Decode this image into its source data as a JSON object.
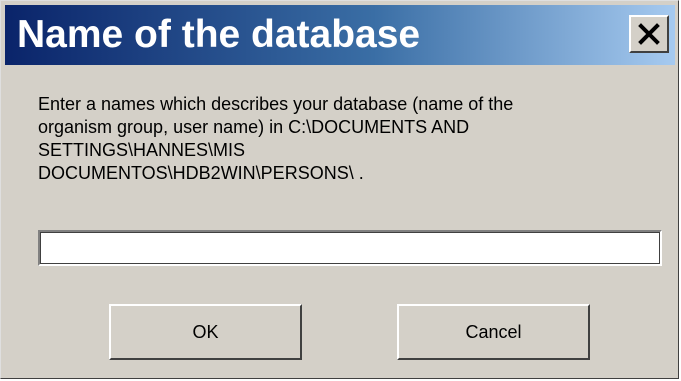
{
  "window": {
    "title": "Name of the database",
    "close_icon": "close-icon"
  },
  "message": {
    "lines": [
      "Enter a names which describes your database (name of the",
      "organism group, user name) in C:\\DOCUMENTS AND",
      "SETTINGS\\HANNES\\MIS",
      "DOCUMENTOS\\HDB2WIN\\PERSONS\\ ."
    ]
  },
  "input": {
    "value": "",
    "placeholder": ""
  },
  "buttons": {
    "ok_label": "OK",
    "cancel_label": "Cancel"
  },
  "colors": {
    "title_gradient_start": "#0a246a",
    "title_gradient_end": "#a6caf0",
    "face": "#d4d0c8"
  }
}
